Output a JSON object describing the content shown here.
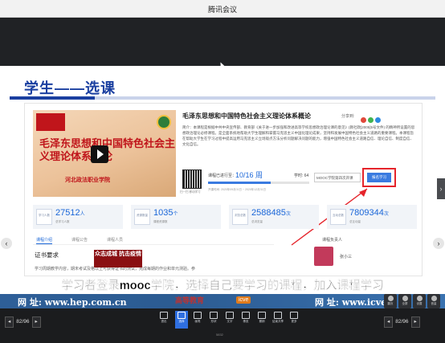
{
  "window": {
    "title": "腾讯会议"
  },
  "slide": {
    "title": "学生——选课",
    "course": {
      "video_title": "毛泽东思想和中国特色社会主义理论体系概论",
      "school": "河北政法职业学院",
      "name": "毛泽东思想和中国特色社会主义理论体系概论",
      "share_label": "分享到:",
      "description": "简介：本课程是根据中共中央宣传部、教育部《关于进一步加强和改进高等学校思想政治理论课的意见》(教社政[2005]5号文件) 的精神所设置的思想政治理论必修课程。是全面系统地帮助大学生理解和掌握马克思主义中国化理论成果，坚持和发展中国特色社会主义道路的重要课程。本课程旨在帮助大学生在学习过程中提高运用马克思主义立场观点方法分析问题解决问题的能力，增强中国特色社会主义道路自信、理论自信、制度自信、文化自信。",
      "qr_caption": "扫一扫 移动学习",
      "progress_label": "课程已进行至：",
      "progress_value": "10/16 周",
      "progress_fraction": 0.62,
      "credits": "学时: 64",
      "dates": "开课时间: 2020年09月01日 ~ 2020年12月31日",
      "select_value": "MOOC学院第四次开课",
      "join_label": "报名学习",
      "join_highlight_color": "#e5242b",
      "accent_color": "#1a66d8"
    },
    "stats": [
      {
        "icon": "学习人数",
        "value": "27512",
        "unit": "人",
        "sub": "总学习人数"
      },
      {
        "icon": "资源数量",
        "value": "1035",
        "unit": "个",
        "sub": "课程资源数"
      },
      {
        "icon": "浏览总数",
        "value": "2588485",
        "unit": "次",
        "sub": "总浏览量"
      },
      {
        "icon": "互动总数",
        "value": "7809344",
        "unit": "次",
        "sub": "总互动量"
      }
    ],
    "tabs": [
      "课程介绍",
      "课程公告",
      "课程人员"
    ],
    "owner_label": "课程负责人",
    "owner_name": "张小三",
    "section_heading": "证书要求",
    "section_text": "学习周期教学内容，期末考试及格以上可获得证书的测试，完成每期的作业和单元测验。参",
    "stamp_text": "众志成城 抗击疫情",
    "caption": "学习者登录mooc学院，选择自己要学习的课程，加入课程学习",
    "footer_url_label_left": "网 址: www.hep.com.cn",
    "footer_mid": "高等教育",
    "footer_icve": "icve",
    "footer_url_label_right": "网 址: www.icve"
  },
  "toolbar": {
    "left_page": "82/96",
    "right_page": "82/96",
    "tools": [
      "退出",
      "选择",
      "画笔",
      "形状",
      "文字",
      "橡皮",
      "撤销",
      "结束共享",
      "更多"
    ],
    "active_tool": 1,
    "slide_number": "5832",
    "tray": [
      "翻页",
      "全屏",
      "设置",
      "音量"
    ]
  }
}
